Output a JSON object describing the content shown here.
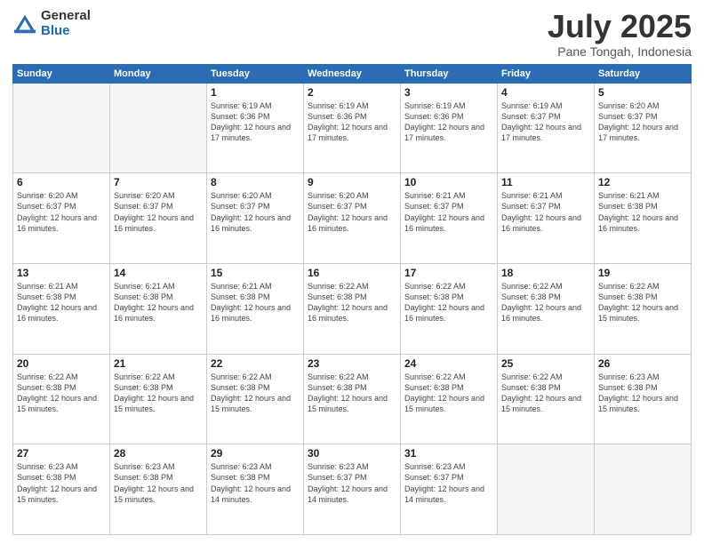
{
  "logo": {
    "general": "General",
    "blue": "Blue"
  },
  "title": "July 2025",
  "subtitle": "Pane Tongah, Indonesia",
  "days_of_week": [
    "Sunday",
    "Monday",
    "Tuesday",
    "Wednesday",
    "Thursday",
    "Friday",
    "Saturday"
  ],
  "weeks": [
    [
      {
        "day": "",
        "info": ""
      },
      {
        "day": "",
        "info": ""
      },
      {
        "day": "1",
        "info": "Sunrise: 6:19 AM\nSunset: 6:36 PM\nDaylight: 12 hours and 17 minutes."
      },
      {
        "day": "2",
        "info": "Sunrise: 6:19 AM\nSunset: 6:36 PM\nDaylight: 12 hours and 17 minutes."
      },
      {
        "day": "3",
        "info": "Sunrise: 6:19 AM\nSunset: 6:36 PM\nDaylight: 12 hours and 17 minutes."
      },
      {
        "day": "4",
        "info": "Sunrise: 6:19 AM\nSunset: 6:37 PM\nDaylight: 12 hours and 17 minutes."
      },
      {
        "day": "5",
        "info": "Sunrise: 6:20 AM\nSunset: 6:37 PM\nDaylight: 12 hours and 17 minutes."
      }
    ],
    [
      {
        "day": "6",
        "info": "Sunrise: 6:20 AM\nSunset: 6:37 PM\nDaylight: 12 hours and 16 minutes."
      },
      {
        "day": "7",
        "info": "Sunrise: 6:20 AM\nSunset: 6:37 PM\nDaylight: 12 hours and 16 minutes."
      },
      {
        "day": "8",
        "info": "Sunrise: 6:20 AM\nSunset: 6:37 PM\nDaylight: 12 hours and 16 minutes."
      },
      {
        "day": "9",
        "info": "Sunrise: 6:20 AM\nSunset: 6:37 PM\nDaylight: 12 hours and 16 minutes."
      },
      {
        "day": "10",
        "info": "Sunrise: 6:21 AM\nSunset: 6:37 PM\nDaylight: 12 hours and 16 minutes."
      },
      {
        "day": "11",
        "info": "Sunrise: 6:21 AM\nSunset: 6:37 PM\nDaylight: 12 hours and 16 minutes."
      },
      {
        "day": "12",
        "info": "Sunrise: 6:21 AM\nSunset: 6:38 PM\nDaylight: 12 hours and 16 minutes."
      }
    ],
    [
      {
        "day": "13",
        "info": "Sunrise: 6:21 AM\nSunset: 6:38 PM\nDaylight: 12 hours and 16 minutes."
      },
      {
        "day": "14",
        "info": "Sunrise: 6:21 AM\nSunset: 6:38 PM\nDaylight: 12 hours and 16 minutes."
      },
      {
        "day": "15",
        "info": "Sunrise: 6:21 AM\nSunset: 6:38 PM\nDaylight: 12 hours and 16 minutes."
      },
      {
        "day": "16",
        "info": "Sunrise: 6:22 AM\nSunset: 6:38 PM\nDaylight: 12 hours and 16 minutes."
      },
      {
        "day": "17",
        "info": "Sunrise: 6:22 AM\nSunset: 6:38 PM\nDaylight: 12 hours and 16 minutes."
      },
      {
        "day": "18",
        "info": "Sunrise: 6:22 AM\nSunset: 6:38 PM\nDaylight: 12 hours and 16 minutes."
      },
      {
        "day": "19",
        "info": "Sunrise: 6:22 AM\nSunset: 6:38 PM\nDaylight: 12 hours and 15 minutes."
      }
    ],
    [
      {
        "day": "20",
        "info": "Sunrise: 6:22 AM\nSunset: 6:38 PM\nDaylight: 12 hours and 15 minutes."
      },
      {
        "day": "21",
        "info": "Sunrise: 6:22 AM\nSunset: 6:38 PM\nDaylight: 12 hours and 15 minutes."
      },
      {
        "day": "22",
        "info": "Sunrise: 6:22 AM\nSunset: 6:38 PM\nDaylight: 12 hours and 15 minutes."
      },
      {
        "day": "23",
        "info": "Sunrise: 6:22 AM\nSunset: 6:38 PM\nDaylight: 12 hours and 15 minutes."
      },
      {
        "day": "24",
        "info": "Sunrise: 6:22 AM\nSunset: 6:38 PM\nDaylight: 12 hours and 15 minutes."
      },
      {
        "day": "25",
        "info": "Sunrise: 6:22 AM\nSunset: 6:38 PM\nDaylight: 12 hours and 15 minutes."
      },
      {
        "day": "26",
        "info": "Sunrise: 6:23 AM\nSunset: 6:38 PM\nDaylight: 12 hours and 15 minutes."
      }
    ],
    [
      {
        "day": "27",
        "info": "Sunrise: 6:23 AM\nSunset: 6:38 PM\nDaylight: 12 hours and 15 minutes."
      },
      {
        "day": "28",
        "info": "Sunrise: 6:23 AM\nSunset: 6:38 PM\nDaylight: 12 hours and 15 minutes."
      },
      {
        "day": "29",
        "info": "Sunrise: 6:23 AM\nSunset: 6:38 PM\nDaylight: 12 hours and 14 minutes."
      },
      {
        "day": "30",
        "info": "Sunrise: 6:23 AM\nSunset: 6:37 PM\nDaylight: 12 hours and 14 minutes."
      },
      {
        "day": "31",
        "info": "Sunrise: 6:23 AM\nSunset: 6:37 PM\nDaylight: 12 hours and 14 minutes."
      },
      {
        "day": "",
        "info": ""
      },
      {
        "day": "",
        "info": ""
      }
    ]
  ]
}
